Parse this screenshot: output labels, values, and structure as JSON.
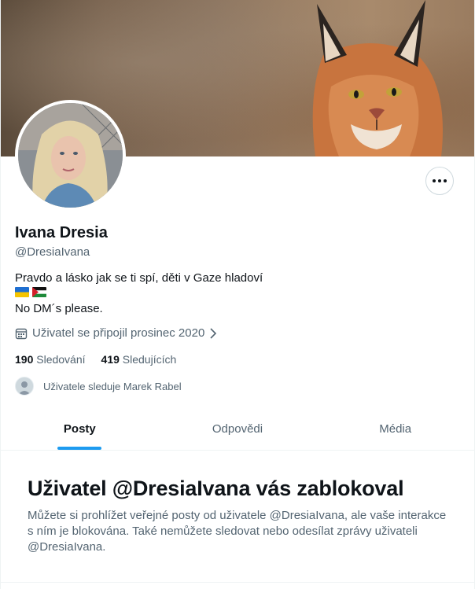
{
  "profile": {
    "name": "Ivana Dresia",
    "handle": "@DresiaIvana",
    "bio_line1": "Pravdo a lásko jak se ti spí, děti v Gaze hladoví",
    "flags": [
      "ukraine-flag",
      "palestine-flag"
    ],
    "bio_line2": "No DM´s please.",
    "joined": "Uživatel se připojil prosinec 2020",
    "following_count": "190",
    "following_label": "Sledování",
    "followers_count": "419",
    "followers_label": "Sledujících",
    "followed_by": "Uživatele sleduje Marek Rabel"
  },
  "tabs": [
    {
      "label": "Posty",
      "active": true
    },
    {
      "label": "Odpovědi",
      "active": false
    },
    {
      "label": "Média",
      "active": false
    }
  ],
  "blocked": {
    "title": "Uživatel @DresiaIvana vás zablokoval",
    "text": "Můžete si prohlížet veřejné posty od uživatele @DresiaIvana, ale vaše interakce s ním je blokována. Také nemůžete sledovat nebo odesílat zprávy uživateli @DresiaIvana."
  },
  "colors": {
    "accent": "#1d9bf0",
    "text": "#0f1419",
    "secondary": "#536471"
  }
}
